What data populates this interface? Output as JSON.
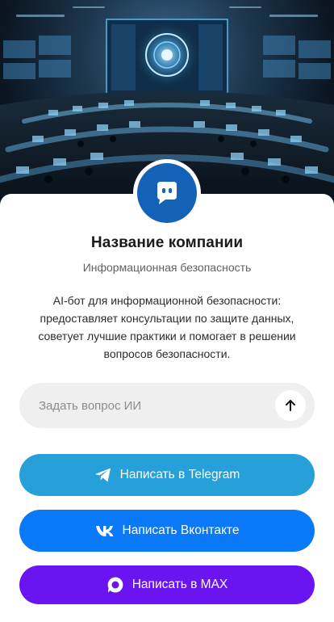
{
  "company": {
    "name": "Название компании",
    "category": "Информационная безопасность",
    "description": "AI-бот для информационной безопасности: предоставляет консультации по защите данных, советует лучшие практики и помогает в решении вопросов безопасности."
  },
  "ask": {
    "placeholder": "Задать вопрос ИИ",
    "send_icon": "arrow-up-icon"
  },
  "buttons": {
    "telegram": {
      "label": "Написать в Telegram",
      "icon": "telegram-icon"
    },
    "vk": {
      "label": "Написать Вконтакте",
      "icon": "vk-icon"
    },
    "max": {
      "label": "Написать в MAX",
      "icon": "max-icon"
    }
  },
  "colors": {
    "telegram": "#279fd9",
    "vk": "#0a79f7",
    "max": "#6a15f1",
    "avatar": "#1462b8"
  }
}
